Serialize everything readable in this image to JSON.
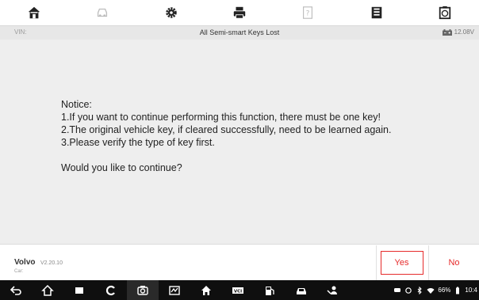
{
  "toolbar": {
    "items": [
      {
        "icon": "home-icon"
      },
      {
        "icon": "vehicle-swap-icon"
      },
      {
        "icon": "settings-gear-icon"
      },
      {
        "icon": "print-icon"
      },
      {
        "icon": "help-icon"
      },
      {
        "icon": "save-icon"
      },
      {
        "icon": "data-logging-icon"
      }
    ]
  },
  "infobar": {
    "vin_label": "VIN:",
    "title": "All Semi-smart Keys Lost",
    "voltage": "12.08V"
  },
  "notice": {
    "heading": "Notice:",
    "line1": "1.If you want to continue performing this function, there must be one key!",
    "line2": "2.The original vehicle key, if cleared successfully, need to be learned again.",
    "line3": "3.Please verify the type of key first.",
    "question": "Would you like to continue?"
  },
  "vehicle": {
    "make": "Volvo",
    "version": "V2.20.10",
    "car_label": "Car:"
  },
  "buttons": {
    "yes": "Yes",
    "no": "No"
  },
  "statusbar": {
    "battery": "66%",
    "time": "10:4"
  },
  "colors": {
    "accent": "#e62b2b",
    "content_bg": "#eeeeee",
    "navbar_bg": "#0f0f0f"
  }
}
